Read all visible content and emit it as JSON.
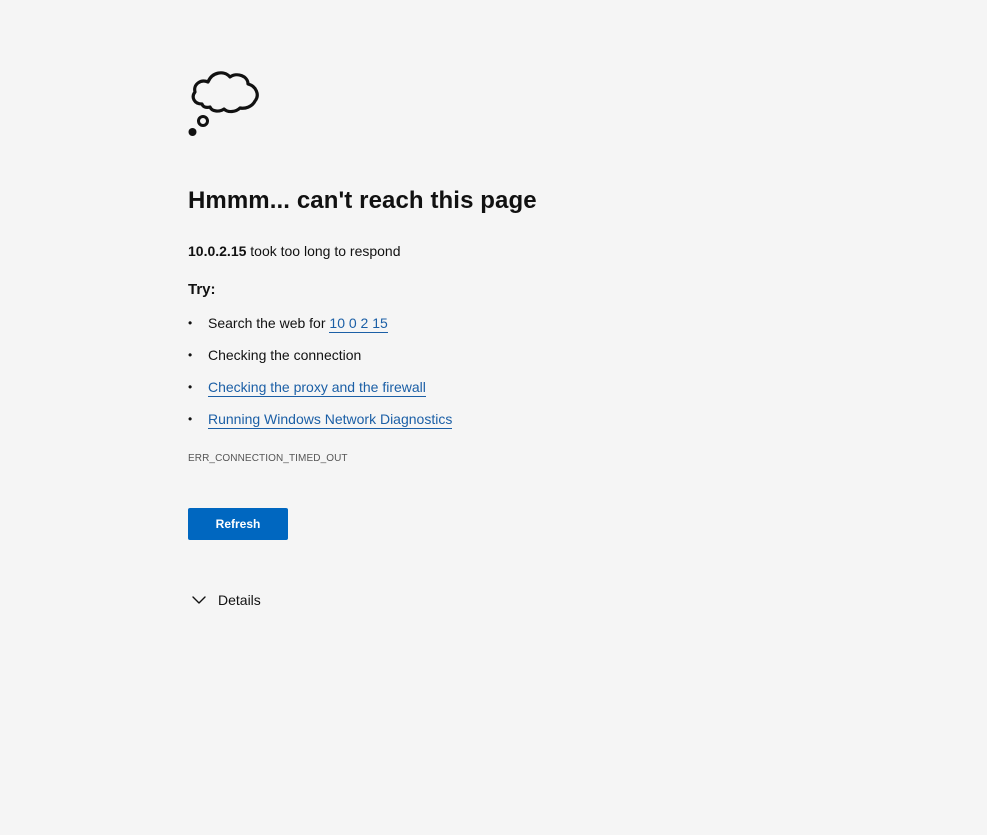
{
  "icon": {
    "name": "thought-cloud-icon"
  },
  "error_page": {
    "heading": "Hmmm... can't reach this page",
    "host": "10.0.2.15",
    "subtitle_suffix": " took too long to respond",
    "try_label": "Try:",
    "suggestions": {
      "search_prefix": "Search the web for ",
      "search_link": "10 0 2 15",
      "check_connection": "Checking the connection",
      "check_proxy": "Checking the proxy and the firewall",
      "run_diagnostics": "Running Windows Network Diagnostics"
    },
    "error_code": "ERR_CONNECTION_TIMED_OUT",
    "refresh_label": "Refresh",
    "details_label": "Details"
  },
  "colors": {
    "background": "#f5f5f5",
    "link": "#1b5fa6",
    "primary_button": "#0067c0"
  }
}
